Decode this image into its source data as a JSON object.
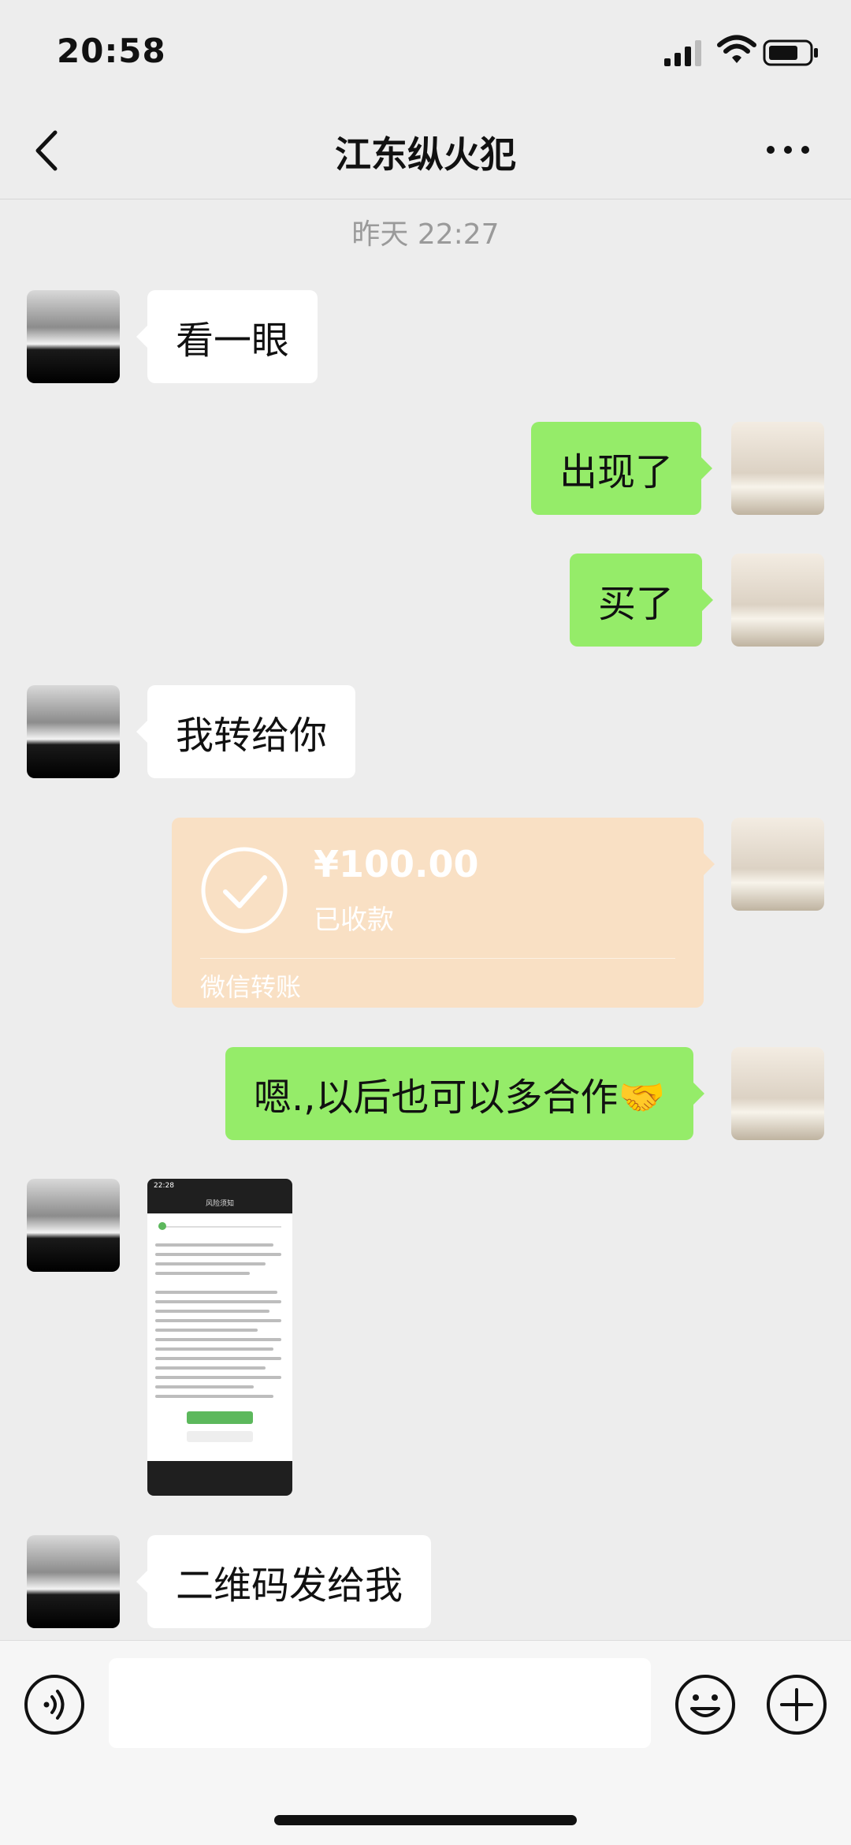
{
  "status_bar": {
    "time": "20:58"
  },
  "header": {
    "title": "江东纵火犯"
  },
  "timestamp": "昨天 22:27",
  "messages": [
    {
      "side": "left",
      "text": "看一眼"
    },
    {
      "side": "right",
      "text": "出现了"
    },
    {
      "side": "right",
      "text": "买了"
    },
    {
      "side": "left",
      "text": "我转给你"
    },
    {
      "side": "right",
      "type": "transfer",
      "amount": "¥100.00",
      "status": "已收款",
      "label": "微信转账"
    },
    {
      "side": "right",
      "text": "嗯.,以后也可以多合作🤝"
    },
    {
      "side": "left",
      "type": "image",
      "image_time": "22:28",
      "image_title": "风险须知"
    },
    {
      "side": "left",
      "text": "二维码发给我"
    }
  ],
  "icons": {
    "back": "chevron-left-icon",
    "more": "more-dots-icon",
    "voice": "voice-icon",
    "emoji": "emoji-icon",
    "plus": "plus-icon"
  },
  "colors": {
    "background": "#ededed",
    "sent_bubble": "#95ec69",
    "received_bubble": "#ffffff",
    "transfer_card": "#f9e0c4"
  }
}
